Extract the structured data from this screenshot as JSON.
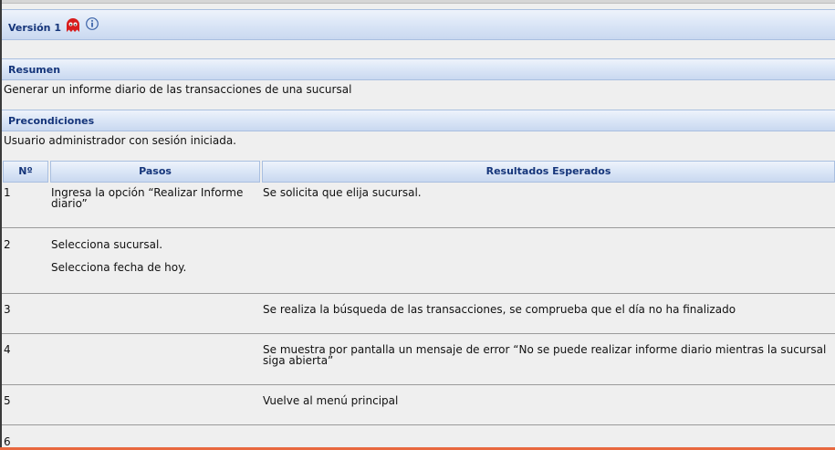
{
  "version": {
    "label": "Versión 1",
    "icons": [
      "ghost-icon",
      "info-icon"
    ]
  },
  "resumen": {
    "heading": "Resumen",
    "text": "Generar un informe diario de las transacciones de una sucursal"
  },
  "precondiciones": {
    "heading": "Precondiciones",
    "text": "Usuario administrador con sesión iniciada."
  },
  "table": {
    "headers": {
      "no": "Nº",
      "pasos": "Pasos",
      "resultados": "Resultados Esperados"
    },
    "rows": [
      {
        "no": "1",
        "pasos": [
          "Ingresa la opción “Realizar Informe diario”"
        ],
        "resultado": "Se solicita que elija sucursal."
      },
      {
        "no": "2",
        "pasos": [
          "Selecciona sucursal.",
          "Selecciona fecha de hoy."
        ],
        "resultado": ""
      },
      {
        "no": "3",
        "pasos": [],
        "resultado": "Se realiza la búsqueda de las transacciones, se comprueba que el día no ha finalizado"
      },
      {
        "no": "4",
        "pasos": [],
        "resultado": "Se muestra por pantalla un mensaje de error “No se puede realizar informe diario mientras la sucursal siga abierta”"
      },
      {
        "no": "5",
        "pasos": [],
        "resultado": "Vuelve al menú principal"
      },
      {
        "no": "6",
        "pasos": [],
        "resultado": ""
      }
    ]
  },
  "colors": {
    "header_text": "#15357a",
    "header_bg": "#dce7f7",
    "bottom_accent": "#e8683f"
  }
}
